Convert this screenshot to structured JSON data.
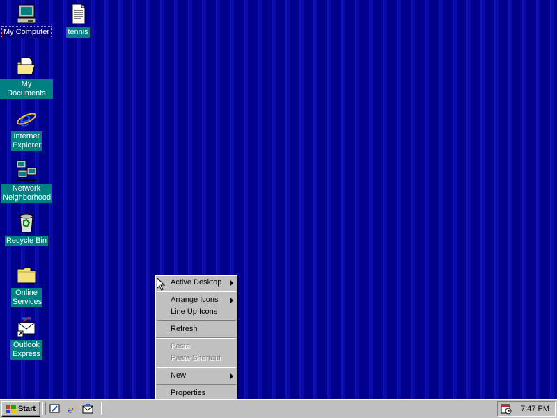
{
  "desktop": {
    "icons": [
      {
        "label": "My Computer",
        "icon": "my-computer-icon"
      },
      {
        "label": "tennis",
        "icon": "text-document-icon"
      },
      {
        "label": "My Documents",
        "icon": "my-documents-folder-icon"
      },
      {
        "label": "Internet Explorer",
        "icon": "internet-explorer-icon"
      },
      {
        "label": "Network Neighborhood",
        "icon": "network-neighborhood-icon"
      },
      {
        "label": "Recycle Bin",
        "icon": "recycle-bin-icon"
      },
      {
        "label": "Online Services",
        "icon": "folder-icon"
      },
      {
        "label": "Outlook Express",
        "icon": "outlook-express-icon"
      }
    ]
  },
  "context_menu": {
    "items": [
      {
        "label": "Active Desktop",
        "submenu": true,
        "enabled": true,
        "bold": false
      },
      {
        "label": "Arrange Icons",
        "submenu": true,
        "enabled": true
      },
      {
        "label": "Line Up Icons",
        "submenu": false,
        "enabled": true
      },
      {
        "label": "Refresh",
        "submenu": false,
        "enabled": true
      },
      {
        "label": "Paste",
        "submenu": false,
        "enabled": false
      },
      {
        "label": "Paste Shortcut",
        "submenu": false,
        "enabled": false
      },
      {
        "label": "New",
        "submenu": true,
        "enabled": true
      },
      {
        "label": "Properties",
        "submenu": false,
        "enabled": true
      }
    ]
  },
  "taskbar": {
    "start_label": "Start",
    "quick_launch": [
      "show-desktop-icon",
      "internet-explorer-icon",
      "outlook-express-icon"
    ],
    "tray": {
      "clock": "7:47 PM",
      "icon": "task-scheduler-icon"
    }
  },
  "colors": {
    "desktop_bg": "#00008c",
    "taskbar": "#c0c0c0",
    "label_bg": "#008080",
    "selection": "#000080"
  }
}
